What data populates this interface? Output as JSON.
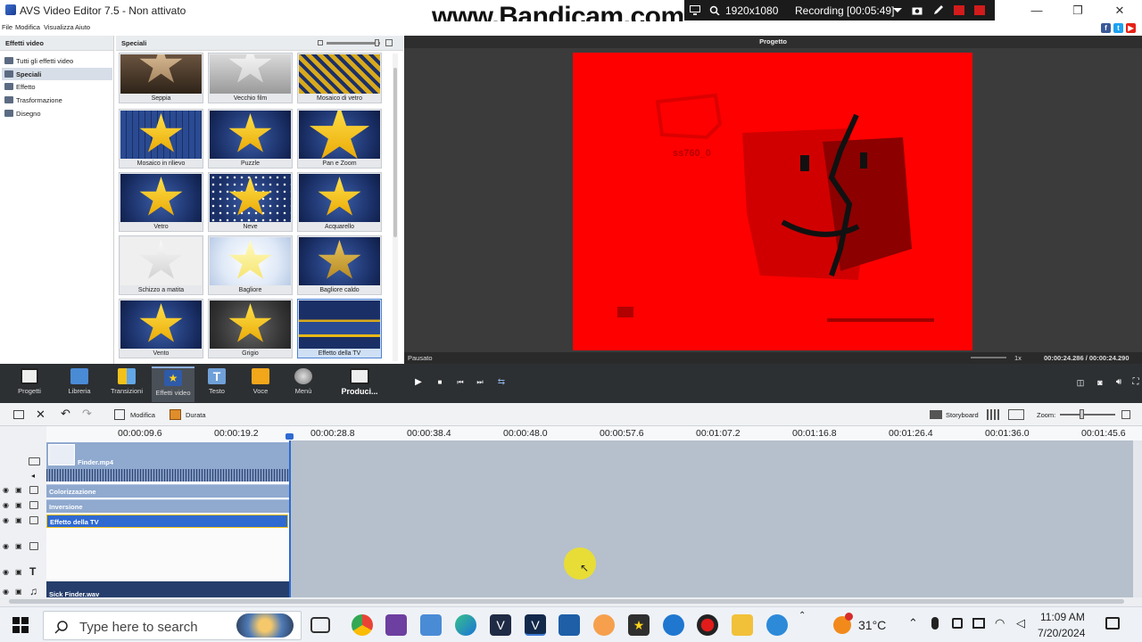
{
  "window": {
    "title": "AVS Video Editor 7.5 - Non attivato"
  },
  "watermark": "www.Bandicam.com",
  "recording": {
    "resolution": "1920x1080",
    "status": "Recording [00:05:49]"
  },
  "menu": [
    "File",
    "Modifica",
    "Visualizza",
    "Aiuto"
  ],
  "left_panel": {
    "header": "Effetti video",
    "items": [
      "Tutti gli effetti video",
      "Speciali",
      "Effetto",
      "Trasformazione",
      "Disegno"
    ]
  },
  "effects_panel": {
    "header": "Speciali",
    "effects": [
      "Seppia",
      "Vecchio film",
      "Mosaico di vetro",
      "Mosaico in rilievo",
      "Puzzle",
      "Pan e Zoom",
      "Vetro",
      "Neve",
      "Acquarello",
      "Schizzo a matita",
      "Bagliore",
      "Bagliore caldo",
      "Vento",
      "Grigio",
      "Effetto della TV"
    ]
  },
  "preview": {
    "header": "Progetto",
    "status": "Pausato",
    "speed": "1x",
    "time": "00:00:24.286 / 00:00:24.290",
    "overlay_text": "ss760_0"
  },
  "toolbar": {
    "items": [
      "Progetti",
      "Libreria",
      "Transizioni",
      "Effetti video",
      "Testo",
      "Voce",
      "Menù",
      "Produci..."
    ]
  },
  "timeline": {
    "modifica": "Modifica",
    "durata": "Durata",
    "storyboard": "Storyboard",
    "zoom": "Zoom:",
    "ruler": [
      "00:00:09.6",
      "00:00:19.2",
      "00:00:28.8",
      "00:00:38.4",
      "00:00:48.0",
      "00:00:57.6",
      "00:01:07.2",
      "00:01:16.8",
      "00:01:26.4",
      "00:01:36.0",
      "00:01:45.6"
    ],
    "clips": {
      "video": "Finder.mp4",
      "fx1": "Colorizzazione",
      "fx2": "Inversione",
      "fx3": "Effetto della TV",
      "audio": "Sick Finder.wav"
    }
  },
  "taskbar": {
    "search_placeholder": "Type here to search",
    "weather": "31°C",
    "time": "11:09 AM",
    "date": "7/20/2024"
  },
  "colors": {
    "accent": "#4d83d1",
    "video_bg": "#ff0000",
    "toolbar_bg": "#2d3033",
    "timeline_bg": "#b6c0cc"
  }
}
